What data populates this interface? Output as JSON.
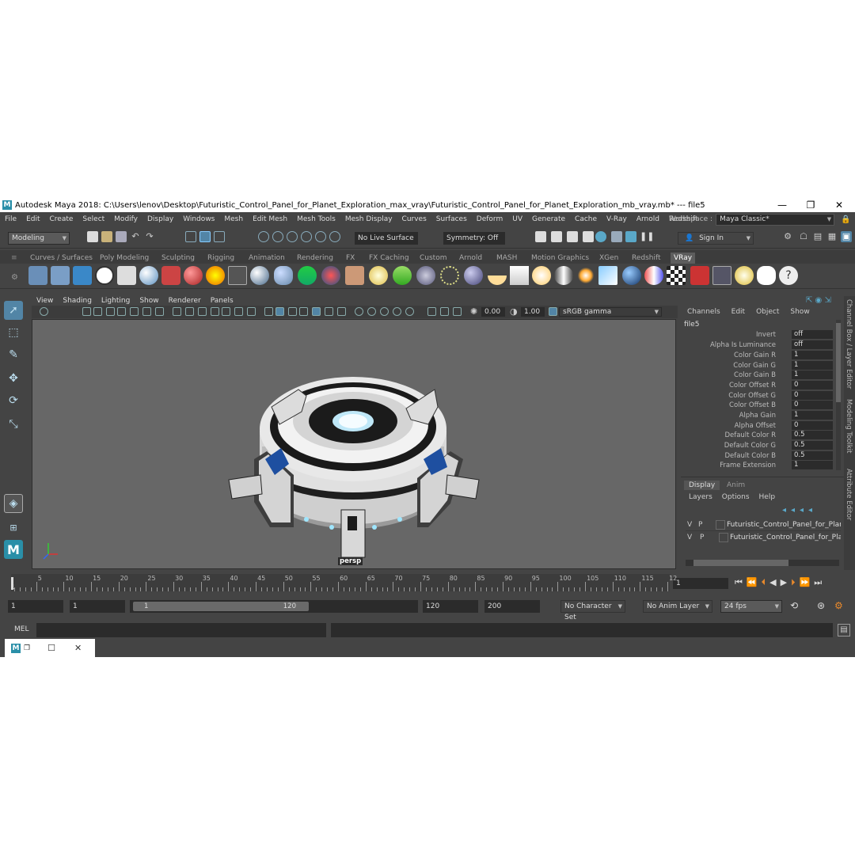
{
  "window": {
    "title": "Autodesk Maya 2018: C:\\Users\\lenov\\Desktop\\Futuristic_Control_Panel_for_Planet_Exploration_max_vray\\Futuristic_Control_Panel_for_Planet_Exploration_mb_vray.mb*  ---   file5",
    "logo": "M"
  },
  "menubar": [
    "File",
    "Edit",
    "Create",
    "Select",
    "Modify",
    "Display",
    "Windows",
    "Mesh",
    "Edit Mesh",
    "Mesh Tools",
    "Mesh Display",
    "Curves",
    "Surfaces",
    "Deform",
    "UV",
    "Generate",
    "Cache",
    "V-Ray",
    "Arnold",
    "Redshift"
  ],
  "workspace": {
    "label": "Workspace :",
    "value": "Maya Classic*"
  },
  "status": {
    "mode": "Modeling",
    "live_surface": "No Live Surface",
    "symmetry": "Symmetry: Off",
    "sign_in": "Sign In"
  },
  "shelf_tabs": [
    "Curves / Surfaces",
    "Poly Modeling",
    "Sculpting",
    "Rigging",
    "Animation",
    "Rendering",
    "FX",
    "FX Caching",
    "Custom",
    "Arnold",
    "MASH",
    "Motion Graphics",
    "XGen",
    "Redshift",
    "VRay"
  ],
  "shelf_active_tab": "VRay",
  "viewport": {
    "menu": [
      "View",
      "Shading",
      "Lighting",
      "Show",
      "Renderer",
      "Panels"
    ],
    "exposure": "0.00",
    "gamma": "1.00",
    "color_space": "sRGB gamma",
    "camera_label": "persp"
  },
  "channel_box": {
    "menu": [
      "Channels",
      "Edit",
      "Object",
      "Show"
    ],
    "node": "file5",
    "attributes": [
      {
        "name": "Invert",
        "value": "off"
      },
      {
        "name": "Alpha Is Luminance",
        "value": "off"
      },
      {
        "name": "Color Gain R",
        "value": "1"
      },
      {
        "name": "Color Gain G",
        "value": "1"
      },
      {
        "name": "Color Gain B",
        "value": "1"
      },
      {
        "name": "Color Offset R",
        "value": "0"
      },
      {
        "name": "Color Offset G",
        "value": "0"
      },
      {
        "name": "Color Offset B",
        "value": "0"
      },
      {
        "name": "Alpha Gain",
        "value": "1"
      },
      {
        "name": "Alpha Offset",
        "value": "0"
      },
      {
        "name": "Default Color R",
        "value": "0.5"
      },
      {
        "name": "Default Color G",
        "value": "0.5"
      },
      {
        "name": "Default Color B",
        "value": "0.5"
      },
      {
        "name": "Frame Extension",
        "value": "1"
      }
    ]
  },
  "layer_editor": {
    "tabs": [
      "Display",
      "Anim"
    ],
    "menu": [
      "Layers",
      "Options",
      "Help"
    ],
    "layers": [
      {
        "v": "V",
        "p": "P",
        "name": "Futuristic_Control_Panel_for_Planet"
      },
      {
        "v": "V",
        "p": "P",
        "name": "Futuristic_Control_Panel_for_Plane"
      }
    ]
  },
  "side_tabs": [
    "Channel Box / Layer Editor",
    "Modeling Toolkit",
    "Attribute Editor"
  ],
  "timeline": {
    "labels": [
      "1",
      "5",
      "10",
      "15",
      "20",
      "25",
      "30",
      "35",
      "40",
      "45",
      "50",
      "55",
      "60",
      "65",
      "70",
      "75",
      "80",
      "85",
      "90",
      "95",
      "100",
      "105",
      "110",
      "115",
      "12"
    ],
    "current_frame": "1"
  },
  "range": {
    "start": "1",
    "playback_start": "1",
    "slider_start": "1",
    "slider_end": "120",
    "playback_end": "120",
    "end": "200",
    "character_set": "No Character Set",
    "anim_layer": "No Anim Layer",
    "fps": "24 fps"
  },
  "command_line": {
    "mode": "MEL"
  },
  "colors": {
    "panel_bg": "#444444",
    "viewport_bg": "#676767",
    "accent": "#5285a6",
    "maya_logo": "#2a8fa8"
  }
}
